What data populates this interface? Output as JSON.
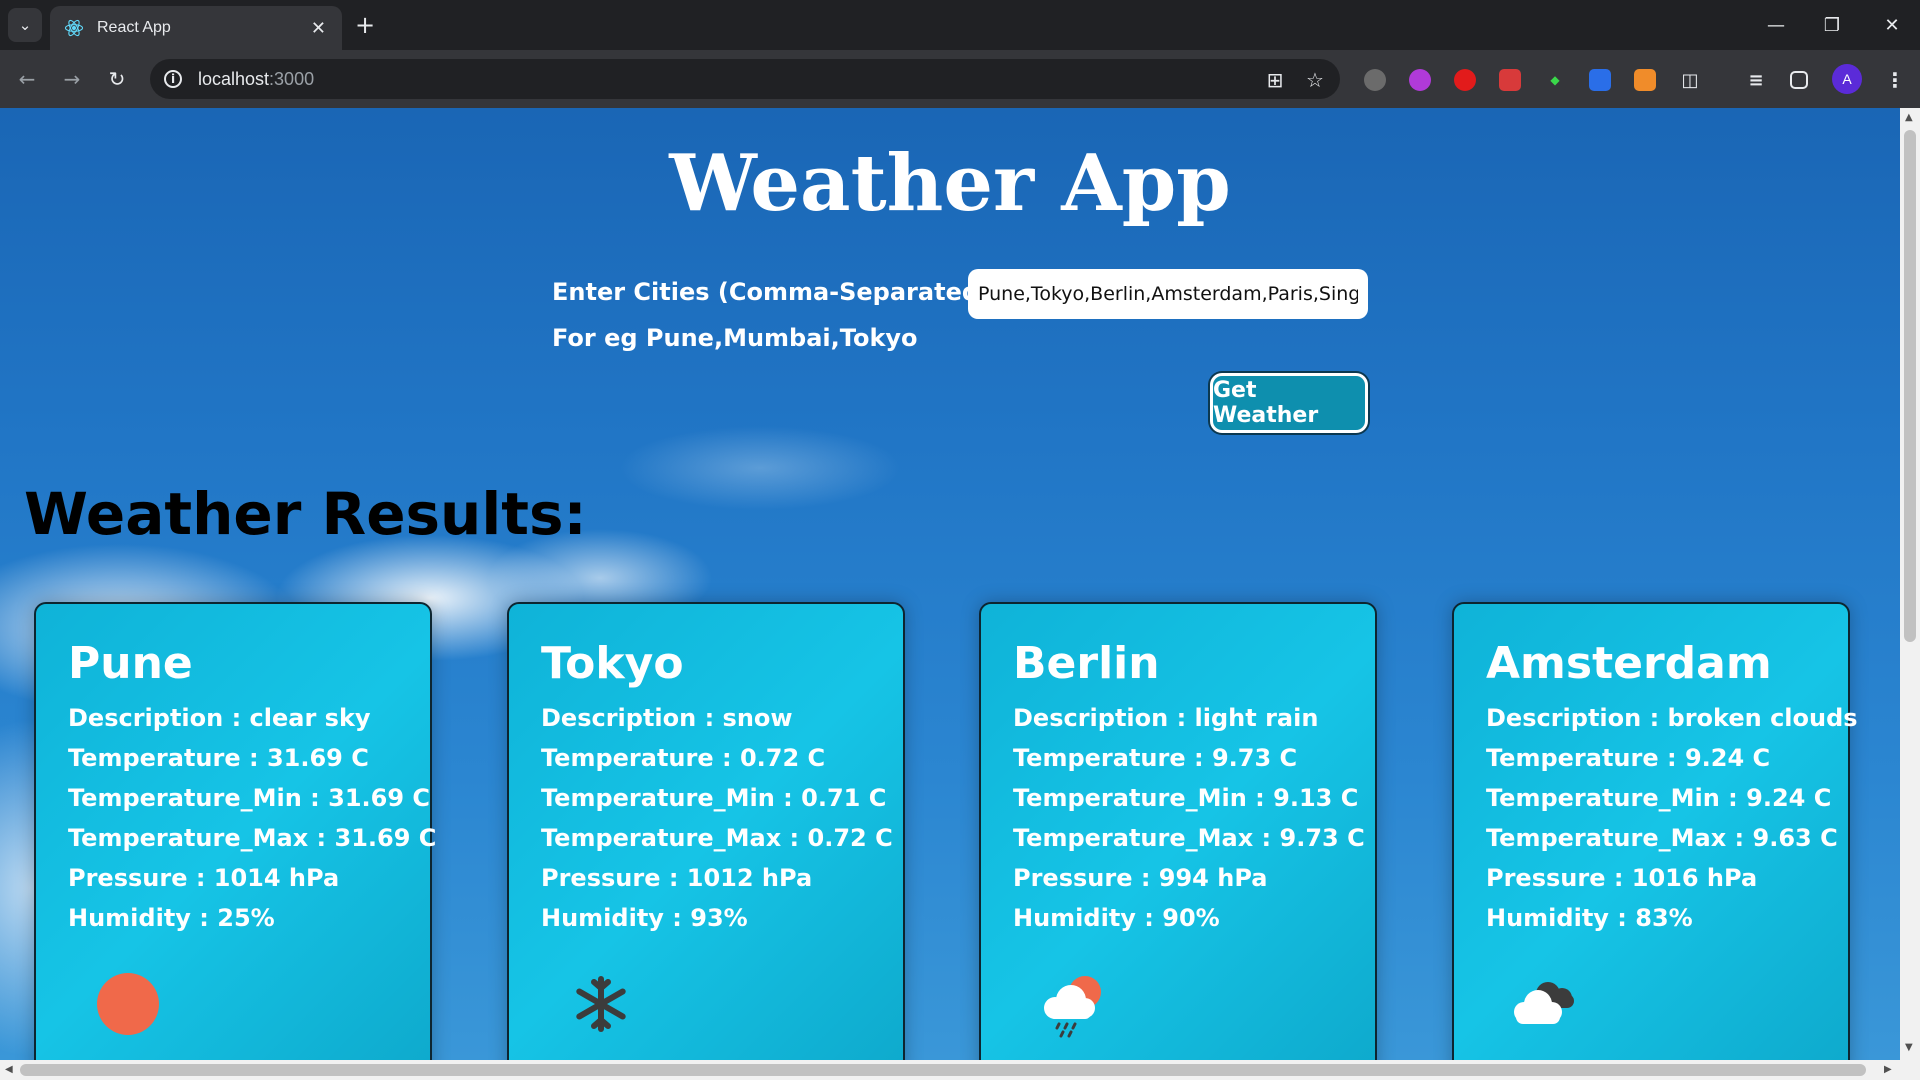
{
  "browser": {
    "tab_title": "React App",
    "url_host": "localhost",
    "url_port": ":3000",
    "avatar_initial": "A"
  },
  "app": {
    "title": "Weather App",
    "input_label": "Enter Cities (Comma-Separated):",
    "hint": "For eg Pune,Mumbai,Tokyo",
    "input_value": "Pune,Tokyo,Berlin,Amsterdam,Paris,Singapore",
    "button_label": "Get Weather",
    "results_title": "Weather Results:"
  },
  "cards": [
    {
      "city": "Pune",
      "description": "Description : clear sky",
      "temperature": "Temperature : 31.69 C",
      "temp_min": "Temperature_Min : 31.69 C",
      "temp_max": "Temperature_Max : 31.69 C",
      "pressure": "Pressure : 1014 hPa",
      "humidity": "Humidity : 25%",
      "icon": "sun-icon"
    },
    {
      "city": "Tokyo",
      "description": "Description : snow",
      "temperature": "Temperature : 0.72 C",
      "temp_min": "Temperature_Min : 0.71 C",
      "temp_max": "Temperature_Max : 0.72 C",
      "pressure": "Pressure : 1012 hPa",
      "humidity": "Humidity : 93%",
      "icon": "snowflake-icon"
    },
    {
      "city": "Berlin",
      "description": "Description : light rain",
      "temperature": "Temperature : 9.73 C",
      "temp_min": "Temperature_Min : 9.13 C",
      "temp_max": "Temperature_Max : 9.73 C",
      "pressure": "Pressure : 994 hPa",
      "humidity": "Humidity : 90%",
      "icon": "rain-cloud-sun-icon"
    },
    {
      "city": "Amsterdam",
      "description": "Description : broken clouds",
      "temperature": "Temperature : 9.24 C",
      "temp_min": "Temperature_Min : 9.24 C",
      "temp_max": "Temperature_Max : 9.63 C",
      "pressure": "Pressure : 1016 hPa",
      "humidity": "Humidity : 83%",
      "icon": "broken-clouds-icon"
    }
  ],
  "colors": {
    "sun": "#f0694a",
    "snowflake": "#3c3c3c",
    "card": "#16c4e6",
    "button": "#0e8fae"
  }
}
